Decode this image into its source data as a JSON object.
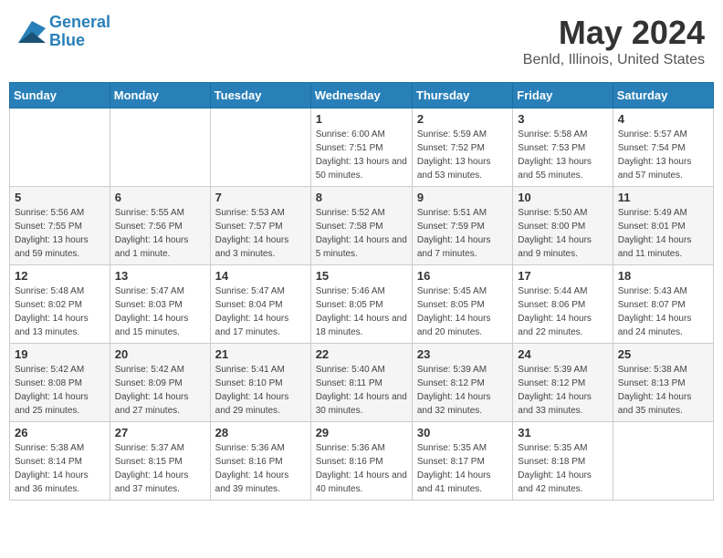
{
  "header": {
    "logo_line1": "General",
    "logo_line2": "Blue",
    "month_title": "May 2024",
    "location": "Benld, Illinois, United States"
  },
  "days_of_week": [
    "Sunday",
    "Monday",
    "Tuesday",
    "Wednesday",
    "Thursday",
    "Friday",
    "Saturday"
  ],
  "weeks": [
    [
      {
        "day": "",
        "sunrise": "",
        "sunset": "",
        "daylight": ""
      },
      {
        "day": "",
        "sunrise": "",
        "sunset": "",
        "daylight": ""
      },
      {
        "day": "",
        "sunrise": "",
        "sunset": "",
        "daylight": ""
      },
      {
        "day": "1",
        "sunrise": "Sunrise: 6:00 AM",
        "sunset": "Sunset: 7:51 PM",
        "daylight": "Daylight: 13 hours and 50 minutes."
      },
      {
        "day": "2",
        "sunrise": "Sunrise: 5:59 AM",
        "sunset": "Sunset: 7:52 PM",
        "daylight": "Daylight: 13 hours and 53 minutes."
      },
      {
        "day": "3",
        "sunrise": "Sunrise: 5:58 AM",
        "sunset": "Sunset: 7:53 PM",
        "daylight": "Daylight: 13 hours and 55 minutes."
      },
      {
        "day": "4",
        "sunrise": "Sunrise: 5:57 AM",
        "sunset": "Sunset: 7:54 PM",
        "daylight": "Daylight: 13 hours and 57 minutes."
      }
    ],
    [
      {
        "day": "5",
        "sunrise": "Sunrise: 5:56 AM",
        "sunset": "Sunset: 7:55 PM",
        "daylight": "Daylight: 13 hours and 59 minutes."
      },
      {
        "day": "6",
        "sunrise": "Sunrise: 5:55 AM",
        "sunset": "Sunset: 7:56 PM",
        "daylight": "Daylight: 14 hours and 1 minute."
      },
      {
        "day": "7",
        "sunrise": "Sunrise: 5:53 AM",
        "sunset": "Sunset: 7:57 PM",
        "daylight": "Daylight: 14 hours and 3 minutes."
      },
      {
        "day": "8",
        "sunrise": "Sunrise: 5:52 AM",
        "sunset": "Sunset: 7:58 PM",
        "daylight": "Daylight: 14 hours and 5 minutes."
      },
      {
        "day": "9",
        "sunrise": "Sunrise: 5:51 AM",
        "sunset": "Sunset: 7:59 PM",
        "daylight": "Daylight: 14 hours and 7 minutes."
      },
      {
        "day": "10",
        "sunrise": "Sunrise: 5:50 AM",
        "sunset": "Sunset: 8:00 PM",
        "daylight": "Daylight: 14 hours and 9 minutes."
      },
      {
        "day": "11",
        "sunrise": "Sunrise: 5:49 AM",
        "sunset": "Sunset: 8:01 PM",
        "daylight": "Daylight: 14 hours and 11 minutes."
      }
    ],
    [
      {
        "day": "12",
        "sunrise": "Sunrise: 5:48 AM",
        "sunset": "Sunset: 8:02 PM",
        "daylight": "Daylight: 14 hours and 13 minutes."
      },
      {
        "day": "13",
        "sunrise": "Sunrise: 5:47 AM",
        "sunset": "Sunset: 8:03 PM",
        "daylight": "Daylight: 14 hours and 15 minutes."
      },
      {
        "day": "14",
        "sunrise": "Sunrise: 5:47 AM",
        "sunset": "Sunset: 8:04 PM",
        "daylight": "Daylight: 14 hours and 17 minutes."
      },
      {
        "day": "15",
        "sunrise": "Sunrise: 5:46 AM",
        "sunset": "Sunset: 8:05 PM",
        "daylight": "Daylight: 14 hours and 18 minutes."
      },
      {
        "day": "16",
        "sunrise": "Sunrise: 5:45 AM",
        "sunset": "Sunset: 8:05 PM",
        "daylight": "Daylight: 14 hours and 20 minutes."
      },
      {
        "day": "17",
        "sunrise": "Sunrise: 5:44 AM",
        "sunset": "Sunset: 8:06 PM",
        "daylight": "Daylight: 14 hours and 22 minutes."
      },
      {
        "day": "18",
        "sunrise": "Sunrise: 5:43 AM",
        "sunset": "Sunset: 8:07 PM",
        "daylight": "Daylight: 14 hours and 24 minutes."
      }
    ],
    [
      {
        "day": "19",
        "sunrise": "Sunrise: 5:42 AM",
        "sunset": "Sunset: 8:08 PM",
        "daylight": "Daylight: 14 hours and 25 minutes."
      },
      {
        "day": "20",
        "sunrise": "Sunrise: 5:42 AM",
        "sunset": "Sunset: 8:09 PM",
        "daylight": "Daylight: 14 hours and 27 minutes."
      },
      {
        "day": "21",
        "sunrise": "Sunrise: 5:41 AM",
        "sunset": "Sunset: 8:10 PM",
        "daylight": "Daylight: 14 hours and 29 minutes."
      },
      {
        "day": "22",
        "sunrise": "Sunrise: 5:40 AM",
        "sunset": "Sunset: 8:11 PM",
        "daylight": "Daylight: 14 hours and 30 minutes."
      },
      {
        "day": "23",
        "sunrise": "Sunrise: 5:39 AM",
        "sunset": "Sunset: 8:12 PM",
        "daylight": "Daylight: 14 hours and 32 minutes."
      },
      {
        "day": "24",
        "sunrise": "Sunrise: 5:39 AM",
        "sunset": "Sunset: 8:12 PM",
        "daylight": "Daylight: 14 hours and 33 minutes."
      },
      {
        "day": "25",
        "sunrise": "Sunrise: 5:38 AM",
        "sunset": "Sunset: 8:13 PM",
        "daylight": "Daylight: 14 hours and 35 minutes."
      }
    ],
    [
      {
        "day": "26",
        "sunrise": "Sunrise: 5:38 AM",
        "sunset": "Sunset: 8:14 PM",
        "daylight": "Daylight: 14 hours and 36 minutes."
      },
      {
        "day": "27",
        "sunrise": "Sunrise: 5:37 AM",
        "sunset": "Sunset: 8:15 PM",
        "daylight": "Daylight: 14 hours and 37 minutes."
      },
      {
        "day": "28",
        "sunrise": "Sunrise: 5:36 AM",
        "sunset": "Sunset: 8:16 PM",
        "daylight": "Daylight: 14 hours and 39 minutes."
      },
      {
        "day": "29",
        "sunrise": "Sunrise: 5:36 AM",
        "sunset": "Sunset: 8:16 PM",
        "daylight": "Daylight: 14 hours and 40 minutes."
      },
      {
        "day": "30",
        "sunrise": "Sunrise: 5:35 AM",
        "sunset": "Sunset: 8:17 PM",
        "daylight": "Daylight: 14 hours and 41 minutes."
      },
      {
        "day": "31",
        "sunrise": "Sunrise: 5:35 AM",
        "sunset": "Sunset: 8:18 PM",
        "daylight": "Daylight: 14 hours and 42 minutes."
      },
      {
        "day": "",
        "sunrise": "",
        "sunset": "",
        "daylight": ""
      }
    ]
  ]
}
